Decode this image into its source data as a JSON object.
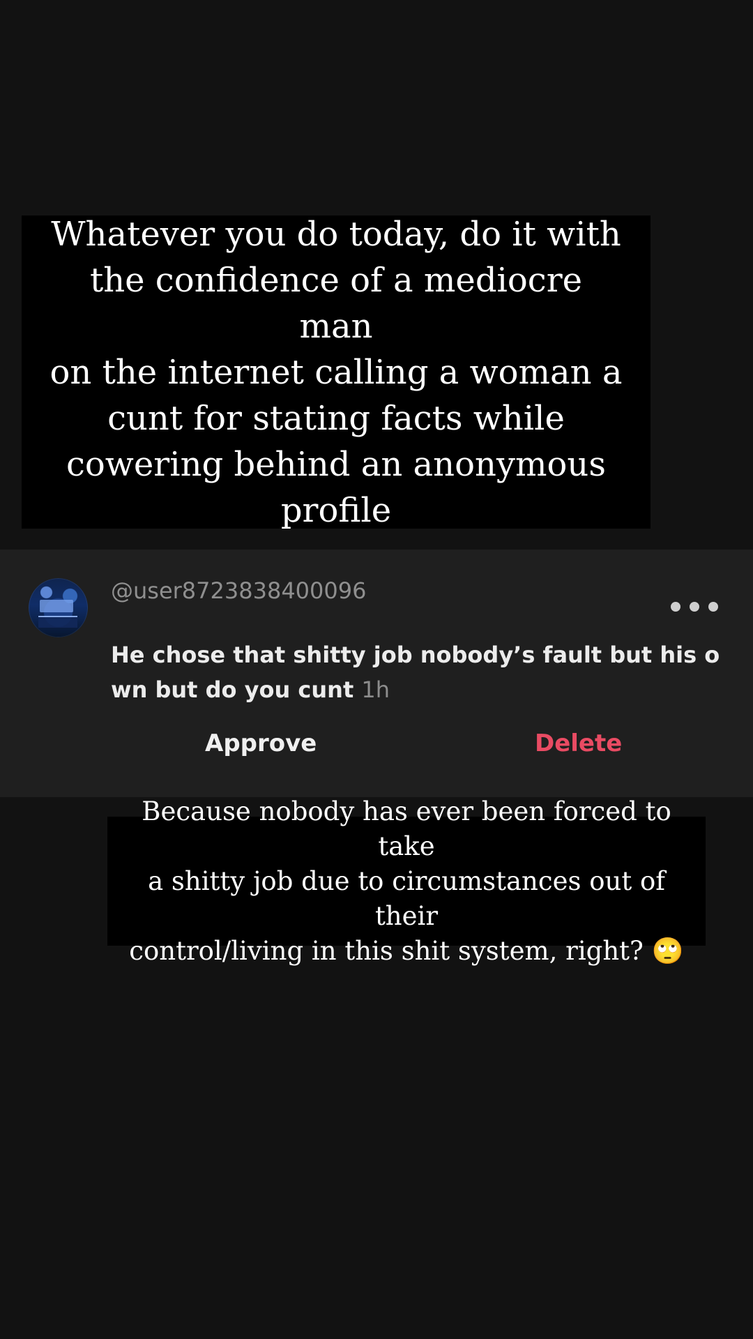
{
  "quote": {
    "text": "Whatever you do today, do it with\nthe confidence of a mediocre man\non the internet calling a woman a\ncunt for stating facts while\ncowering behind an anonymous\nprofile"
  },
  "comment": {
    "username": "@user8723838400096",
    "text": "He chose that shitty job nobody’s fault but his o\nwn but do you cunt ",
    "time": "1h",
    "approve_label": "Approve",
    "delete_label": "Delete",
    "more_icon": "more-horizontal-icon",
    "avatar_icon": "avatar-image"
  },
  "reply": {
    "text": "Because nobody has ever been forced to take\na shitty job due to circumstances out of their\ncontrol/living in this shit system, right? 🙄"
  },
  "colors": {
    "background": "#121212",
    "card": "#1f1f1f",
    "overlay": "#000000",
    "delete": "#e94b63",
    "username": "#8f8f8f"
  }
}
